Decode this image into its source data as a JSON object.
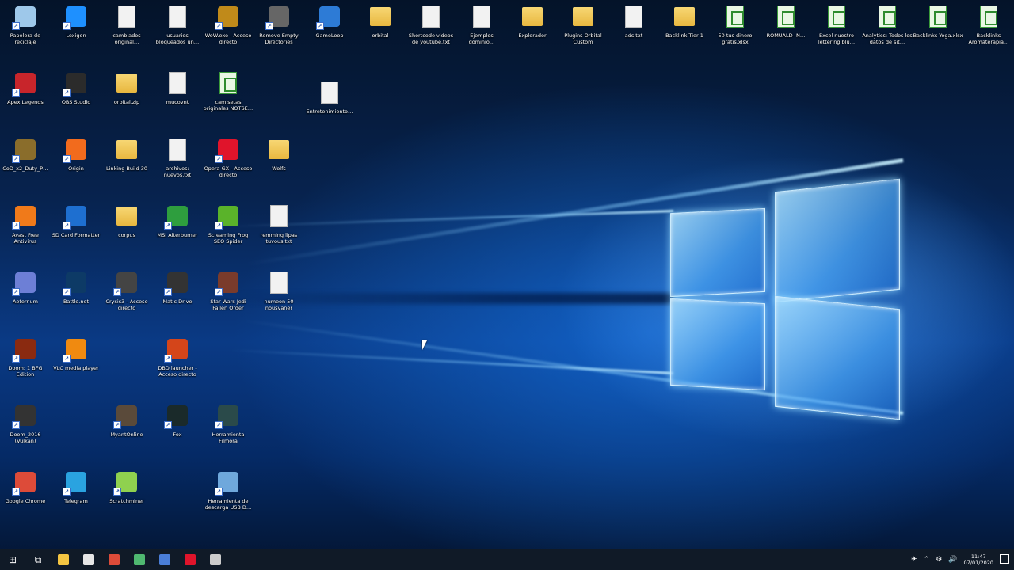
{
  "desktop": {
    "icons": [
      {
        "label": "Papelera de reciclaje",
        "icon": "recycle-bin-icon",
        "kind": "app",
        "color": "#9ec8ea"
      },
      {
        "label": "Lexigon",
        "icon": "app-icon",
        "kind": "app",
        "color": "#1e90ff"
      },
      {
        "label": "cambiados original…",
        "icon": "document-icon",
        "kind": "doc"
      },
      {
        "label": "usuarios bloqueados un…",
        "icon": "document-icon",
        "kind": "doc"
      },
      {
        "label": "WoW.exe - Acceso directo",
        "icon": "game-icon",
        "kind": "app",
        "color": "#c08a1a"
      },
      {
        "label": "Remove Empty Directories",
        "icon": "app-icon",
        "kind": "app",
        "color": "#666666"
      },
      {
        "label": "GameLoop",
        "icon": "app-icon",
        "kind": "app",
        "color": "#2d7bd6"
      },
      {
        "label": "orbital",
        "icon": "folder-icon",
        "kind": "folder"
      },
      {
        "label": "Shortcode videos de youtube.txt",
        "icon": "document-icon",
        "kind": "doc"
      },
      {
        "label": "Ejemplos dominio…",
        "icon": "document-icon",
        "kind": "doc"
      },
      {
        "label": "Explorador",
        "icon": "folder-icon",
        "kind": "folder"
      },
      {
        "label": "Plugins Orbital Custom",
        "icon": "folder-icon",
        "kind": "folder"
      },
      {
        "label": "ads.txt",
        "icon": "document-icon",
        "kind": "doc"
      },
      {
        "label": "Backlink Tier 1",
        "icon": "folder-icon",
        "kind": "folder"
      },
      {
        "label": "50 tus dinero gratis.xlsx",
        "icon": "spreadsheet-icon",
        "kind": "sheet"
      },
      {
        "label": "ROMUALD- N…",
        "icon": "spreadsheet-icon",
        "kind": "sheet"
      },
      {
        "label": "Excel nuestro lettering blu…",
        "icon": "spreadsheet-icon",
        "kind": "sheet"
      },
      {
        "label": "Analytics: Todos los datos de sit…",
        "icon": "spreadsheet-icon",
        "kind": "sheet"
      },
      {
        "label": "Backlinks Yoga.xlsx",
        "icon": "spreadsheet-icon",
        "kind": "sheet"
      },
      {
        "label": "Backlinks Aromaterapia…",
        "icon": "spreadsheet-icon",
        "kind": "sheet"
      },
      {
        "label": "Apex Legends",
        "icon": "game-icon",
        "kind": "app",
        "color": "#c8252b"
      },
      {
        "label": "OBS Studio",
        "icon": "app-icon",
        "kind": "app",
        "color": "#2b2b2b"
      },
      {
        "label": "orbital.zip",
        "icon": "zip-icon",
        "kind": "folder"
      },
      {
        "label": "mucovnt",
        "icon": "document-icon",
        "kind": "doc"
      },
      {
        "label": "camisetas originales NOTSE…",
        "icon": "spreadsheet-icon",
        "kind": "sheet"
      },
      {
        "label": "Entretenimiento…",
        "icon": "app-icon",
        "kind": "doc"
      },
      {
        "label": "CoD_x2_Duty_P…",
        "icon": "game-icon",
        "kind": "app",
        "color": "#8a6d2b"
      },
      {
        "label": "Origin",
        "icon": "app-icon",
        "kind": "app",
        "color": "#f26b1d"
      },
      {
        "label": "Linking Build 30",
        "icon": "document-icon",
        "kind": "folder"
      },
      {
        "label": "archivos: nuevos.txt",
        "icon": "document-icon",
        "kind": "doc"
      },
      {
        "label": "Opera GX - Acceso directo",
        "icon": "browser-icon",
        "kind": "app",
        "color": "#e0142b"
      },
      {
        "label": "Wolfs",
        "icon": "folder-icon",
        "kind": "folder"
      },
      {
        "label": "Avast Free Antivirus",
        "icon": "antivirus-icon",
        "kind": "app",
        "color": "#f07a1a"
      },
      {
        "label": "SD Card Formatter",
        "icon": "app-icon",
        "kind": "app",
        "color": "#1e6fd0"
      },
      {
        "label": "corpus",
        "icon": "folder-icon",
        "kind": "folder"
      },
      {
        "label": "MSI Afterburner",
        "icon": "app-icon",
        "kind": "app",
        "color": "#2e9e3e"
      },
      {
        "label": "Screaming Frog SEO Spider",
        "icon": "app-icon",
        "kind": "app",
        "color": "#5ab32a"
      },
      {
        "label": "remming lipas tuvous.txt",
        "icon": "document-icon",
        "kind": "doc"
      },
      {
        "label": "Aeternum",
        "icon": "app-icon",
        "kind": "app",
        "color": "#6d7fd6"
      },
      {
        "label": "Battle.net",
        "icon": "app-icon",
        "kind": "app",
        "color": "#0d3a66"
      },
      {
        "label": "Crysis3 - Acceso directo",
        "icon": "game-icon",
        "kind": "app",
        "color": "#444444"
      },
      {
        "label": "Matic Drive",
        "icon": "app-icon",
        "kind": "app",
        "color": "#333333"
      },
      {
        "label": "Star Wars Jedi Fallen Order",
        "icon": "game-icon",
        "kind": "app",
        "color": "#7a3b2b"
      },
      {
        "label": "numeon 50 nousvaner",
        "icon": "document-icon",
        "kind": "doc"
      },
      {
        "label": "Doom: 1 BFG Edition",
        "icon": "game-icon",
        "kind": "app",
        "color": "#8a2a10"
      },
      {
        "label": "VLC media player",
        "icon": "app-icon",
        "kind": "app",
        "color": "#f08a10"
      },
      {
        "label": "DBD launcher - Acceso directo",
        "icon": "game-icon",
        "kind": "app",
        "color": "#d4451a"
      },
      {
        "label": "Doom_2016 (Vulkan)",
        "icon": "game-icon",
        "kind": "app",
        "color": "#333333"
      },
      {
        "label": "MyantOnline",
        "icon": "game-icon",
        "kind": "app",
        "color": "#5a4a3a"
      },
      {
        "label": "Fox",
        "icon": "app-icon",
        "kind": "app",
        "color": "#1a2a2a"
      },
      {
        "label": "Herramienta Filmora",
        "icon": "app-icon",
        "kind": "app",
        "color": "#2a4a4a"
      },
      {
        "label": "Google Chrome",
        "icon": "chrome-icon",
        "kind": "app",
        "color": "#dd4b39"
      },
      {
        "label": "Telegram",
        "icon": "telegram-icon",
        "kind": "app",
        "color": "#2aa3e0"
      },
      {
        "label": "Scratchminer",
        "icon": "app-icon",
        "kind": "app",
        "color": "#8fd14f"
      },
      {
        "label": "Herramienta de descarga USB D…",
        "icon": "app-icon",
        "kind": "app",
        "color": "#6fa8dc"
      }
    ]
  },
  "taskbar": {
    "start_icon": "windows-start-icon",
    "apps": [
      {
        "name": "file-explorer-icon",
        "color": "#f4c542"
      },
      {
        "name": "store-icon",
        "color": "#e6e6e6"
      },
      {
        "name": "chrome-icon",
        "color": "#dd4b39"
      },
      {
        "name": "telegram-icon",
        "color": "#4fb870"
      },
      {
        "name": "remote-icon",
        "color": "#4a7ed8"
      },
      {
        "name": "opera-icon",
        "color": "#e0142b"
      },
      {
        "name": "obs-icon",
        "color": "#cccccc"
      }
    ],
    "clock_time": "11:47",
    "clock_date": "07/01/2020"
  }
}
